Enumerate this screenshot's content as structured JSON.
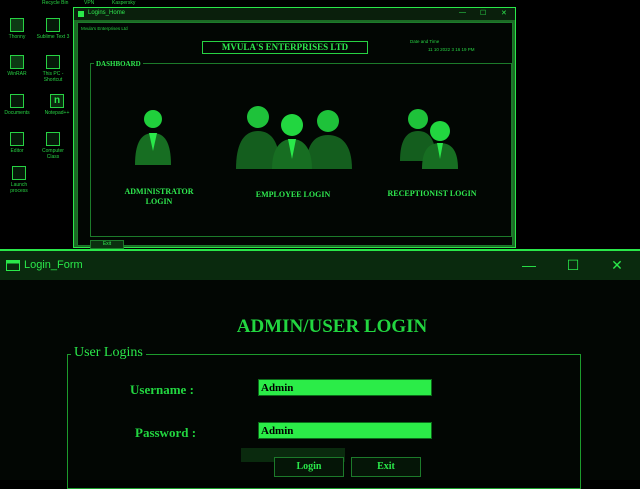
{
  "desktop": {
    "top_clipped": [
      "Recycle Bin",
      "VPN",
      "Kaspersky"
    ],
    "icons": [
      {
        "label": "Thonny",
        "icon": "thonny-icon"
      },
      {
        "label": "Sublime Text 3",
        "icon": "sublime-text-icon"
      },
      {
        "label": "WinRAR",
        "icon": "winrar-icon"
      },
      {
        "label": "This PC - Shortcut",
        "icon": "this-pc-icon"
      },
      {
        "label": "Documents",
        "icon": "documents-icon"
      },
      {
        "label": "Notepad++",
        "icon": "notepad-plus-icon"
      },
      {
        "label": "Editor",
        "icon": "editor-icon"
      },
      {
        "label": "Computer Class",
        "icon": "computer-class-icon"
      },
      {
        "label": "Launch process",
        "icon": "launch-process-icon"
      }
    ]
  },
  "home_window": {
    "title": "Logins_Home",
    "infobar": "Mvula's Enterprises Ltd",
    "company_name": "MVULA'S ENTERPRISES LTD",
    "datetime_label": "Date and Time",
    "datetime_value": "11 10 2022 3 16 19 PM",
    "dashboard_legend": "DASHBOARD",
    "roles": {
      "admin": {
        "line1": "ADMINISTRATOR",
        "line2": "LOGIN"
      },
      "employee": "EMPLOYEE LOGIN",
      "receptionist": "RECEPTIONIST LOGIN"
    },
    "exit_label": "Exit"
  },
  "login_window": {
    "title": "Login_Form",
    "heading": "ADMIN/USER LOGIN",
    "group_legend": "User Logins",
    "username_label": "Username :",
    "username_value": "Admin",
    "password_label": "Password :",
    "password_value": "Admin",
    "login_label": "Login",
    "exit_label": "Exit",
    "controls": {
      "minimize": "—",
      "maximize": "☐",
      "close": "✕"
    }
  },
  "colors": {
    "accent": "#2ae84a",
    "field_fill": "#2bec48",
    "background": "#000000"
  }
}
